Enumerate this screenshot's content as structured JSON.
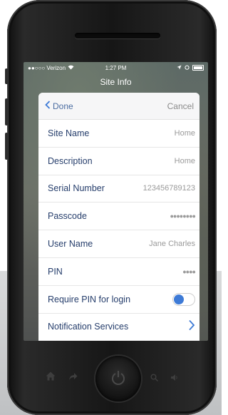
{
  "status_bar": {
    "carrier": "●●○○○ Verizon",
    "time": "1:27 PM",
    "icons": [
      "wifi-icon",
      "location-icon",
      "alarm-icon",
      "battery-icon"
    ]
  },
  "nav": {
    "title": "Site Info"
  },
  "sheet": {
    "done_label": "Done",
    "cancel_label": "Cancel",
    "rows": [
      {
        "label": "Site Name",
        "value": "Home"
      },
      {
        "label": "Description",
        "value": "Home"
      },
      {
        "label": "Serial Number",
        "value": "123456789123"
      },
      {
        "label": "Passcode",
        "value": "●●●●●●●●"
      },
      {
        "label": "User Name",
        "value": "Jane Charles"
      },
      {
        "label": "PIN",
        "value": "●●●●"
      },
      {
        "label": "Require PIN for login",
        "toggle": true
      },
      {
        "label": "Notification Services",
        "chevron": true
      }
    ]
  },
  "device": {
    "bottom_icons": [
      "home-icon",
      "share-icon",
      "power-icon",
      "search-icon",
      "volume-icon"
    ]
  },
  "colors": {
    "accent": "#3d7ad6",
    "label": "#253d6b",
    "value": "#9a9a9a"
  }
}
